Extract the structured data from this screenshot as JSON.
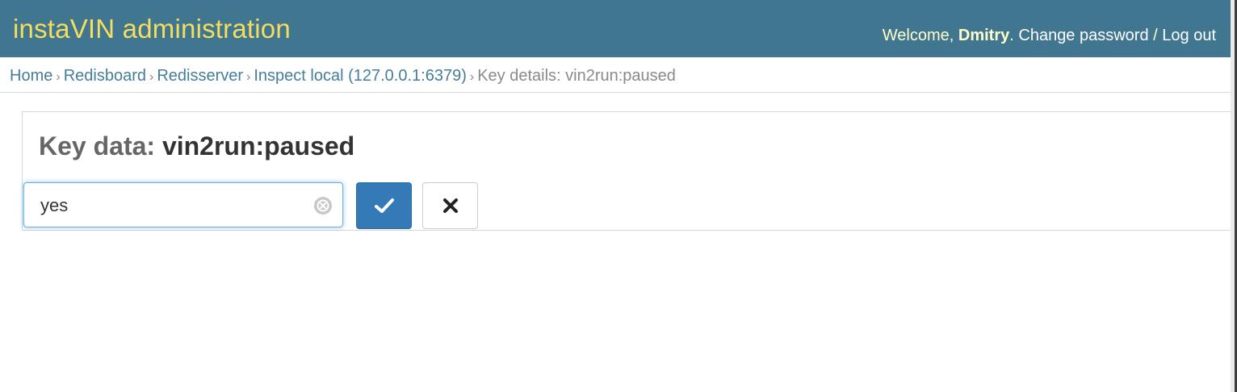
{
  "header": {
    "brand": "instaVIN administration",
    "welcome": "Welcome,",
    "username": "Dmitry",
    "period": ".",
    "change_password": "Change password",
    "separator": " / ",
    "logout": "Log out"
  },
  "breadcrumbs": {
    "items": [
      "Home",
      "Redisboard",
      "Redisserver",
      "Inspect local (127.0.0.1:6379)"
    ],
    "current": "Key details: vin2run:paused",
    "sep": "›"
  },
  "module": {
    "title_prefix": "Key data:",
    "key_name": "vin2run:paused",
    "input_value": "yes"
  },
  "icons": {
    "clear": "clear-circle-icon",
    "ok": "check-icon",
    "cancel": "close-icon"
  },
  "colors": {
    "header_bg": "#417690",
    "brand": "#f5dd5d",
    "link": "#447e9b",
    "primary_button": "#337ab7"
  }
}
